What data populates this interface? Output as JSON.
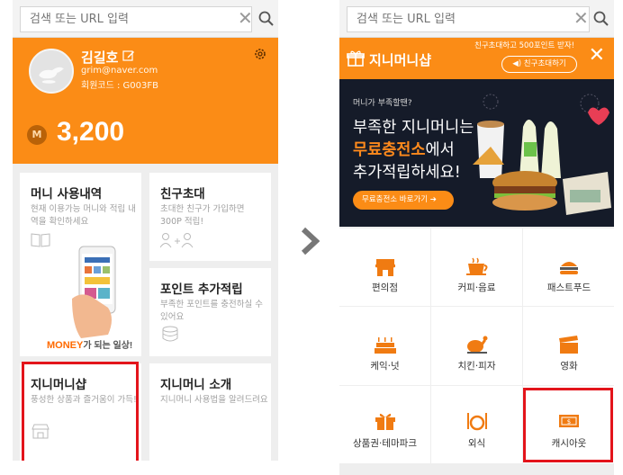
{
  "left_phone": {
    "search": {
      "placeholder": "검색 또는 URL 입력",
      "clear_glyph": "✕"
    },
    "profile": {
      "name": "김길호",
      "email": "grim@naver.com",
      "member_code": "회원코드 : G003FB",
      "coin_glyph": "M",
      "balance": "3,200"
    },
    "cards": {
      "money_history": {
        "title": "머니 사용내역",
        "desc": "현재 이용가능 머니와 적립 내역을 확인하세요"
      },
      "invite": {
        "title": "친구초대",
        "desc": "초대한 친구가 가입하면 300P 적립!"
      },
      "points": {
        "title": "포인트 추가적립",
        "desc": "부족한 포인트를 충전하실 수 있어요"
      },
      "shop": {
        "title": "지니머니샵",
        "desc": "풍성한 상품과 즐거움이 가득!"
      },
      "intro": {
        "title": "지니머니 소개",
        "desc": "지니머니 사용법을 알려드려요"
      }
    },
    "money_banner": {
      "big": "MONEY",
      "rest": "가 되는 일상!"
    }
  },
  "right_phone": {
    "search": {
      "placeholder": "검색 또는 URL 입력",
      "clear_glyph": "✕"
    },
    "header": {
      "title": "지니머니샵",
      "invite_promo": "친구초대하고 500포인트 받자!",
      "invite_button": "◀) 친구초대하기",
      "close_glyph": "✕"
    },
    "banner": {
      "small": "머니가 부족할땐?",
      "line1": "부족한 지니머니는",
      "line2_highlight": "무료충전소",
      "line2_rest": "에서",
      "line3": "추가적립하세요!",
      "button": "무료충전소 바로가기 ➔"
    },
    "categories": [
      {
        "label": "편의점",
        "icon": "store-icon"
      },
      {
        "label": "커피·음료",
        "icon": "coffee-icon"
      },
      {
        "label": "패스트푸드",
        "icon": "burger-icon"
      },
      {
        "label": "케익·넛",
        "icon": "cake-icon"
      },
      {
        "label": "치킨·피자",
        "icon": "chicken-icon"
      },
      {
        "label": "영화",
        "icon": "movie-icon"
      },
      {
        "label": "상품권·테마파크",
        "icon": "gift-box-icon"
      },
      {
        "label": "외식",
        "icon": "dining-icon"
      },
      {
        "label": "캐시아웃",
        "icon": "cash-icon"
      }
    ]
  },
  "colors": {
    "brand_orange": "#fb8c16",
    "highlight_red": "#e3141b",
    "banner_dark": "#151b29"
  }
}
